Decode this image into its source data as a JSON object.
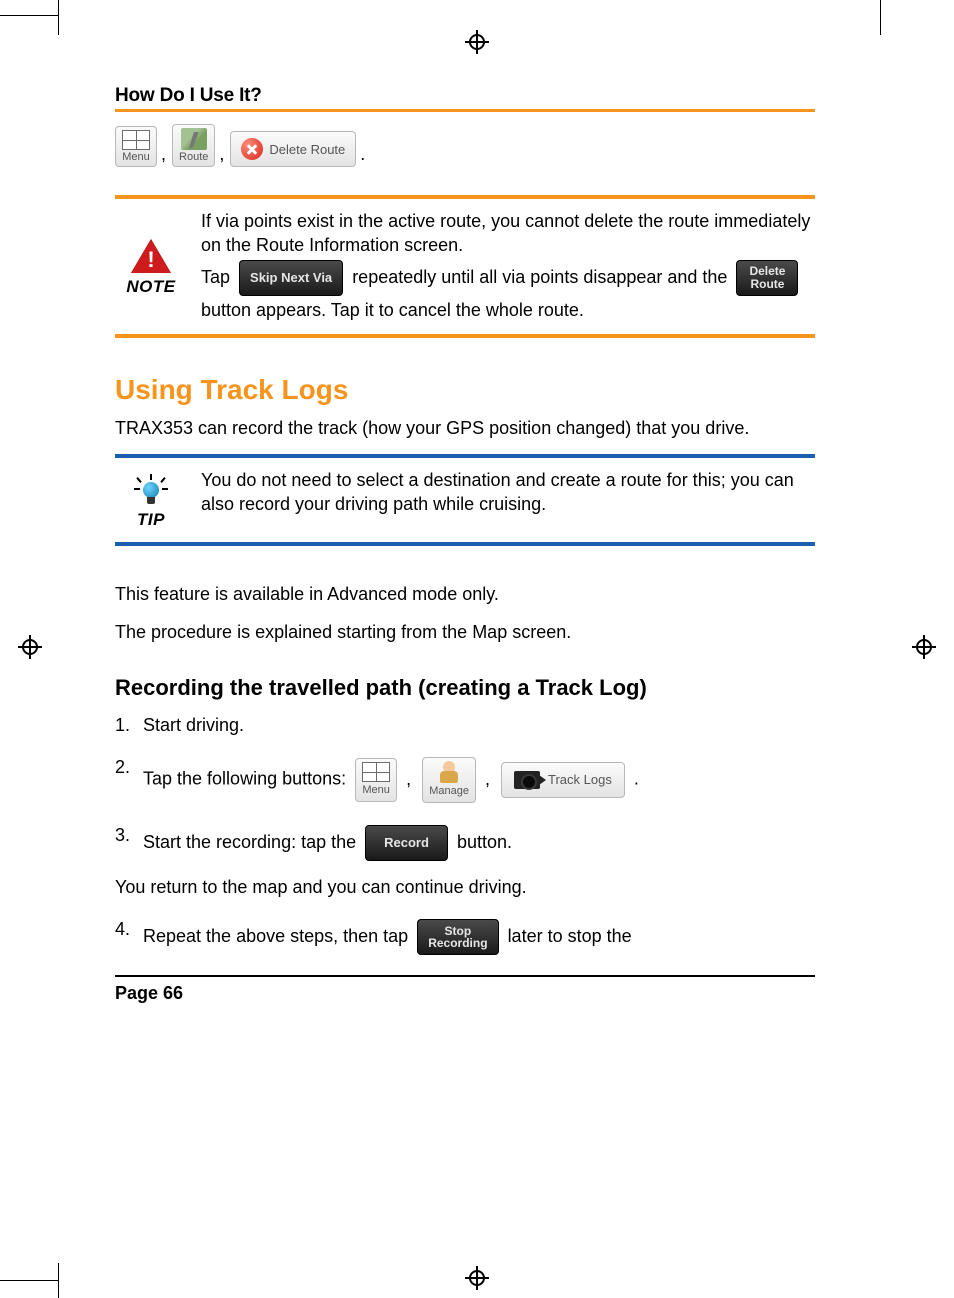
{
  "header": "How Do I Use It?",
  "iconRow": {
    "menu": "Menu",
    "route": "Route",
    "deleteRoute": "Delete Route"
  },
  "note": {
    "label": "NOTE",
    "line1": "If via points exist in the active route, you cannot delete the route immediately on the Route Information screen.",
    "tapWord": "Tap ",
    "skipBtn": "Skip Next Via",
    "afterSkip": " repeatedly until all via points disappear and the ",
    "deleteBtnL1": "Delete",
    "deleteBtnL2": "Route",
    "afterDelete": " button appears. Tap it to cancel the whole route."
  },
  "sectionTitle": "Using Track Logs",
  "sectionIntro": "TRAX353 can record the track (how your GPS position changed) that you drive.",
  "tip": {
    "label": "TIP",
    "body": "You do not need to select a destination and create a route for this; you can also record your driving path while cruising."
  },
  "advanced": "This feature is available in Advanced mode only.",
  "procIntro": "The procedure is explained starting from the Map screen.",
  "subTitle": "Recording the travelled path (creating a Track Log)",
  "steps": {
    "s1": "Start driving.",
    "s2_pre": "Tap the following buttons: ",
    "s2_menu": "Menu",
    "s2_manage": "Manage",
    "s2_track": "Track Logs",
    "s3_pre": "Start the recording: tap the ",
    "s3_btn": "Record",
    "s3_post": " button.",
    "between": "You return to the map and you can continue driving.",
    "s4_pre": "Repeat the above steps, then tap ",
    "s4_btnL1": "Stop",
    "s4_btnL2": "Recording",
    "s4_post": " later to stop the"
  },
  "pageNum": "Page 66"
}
